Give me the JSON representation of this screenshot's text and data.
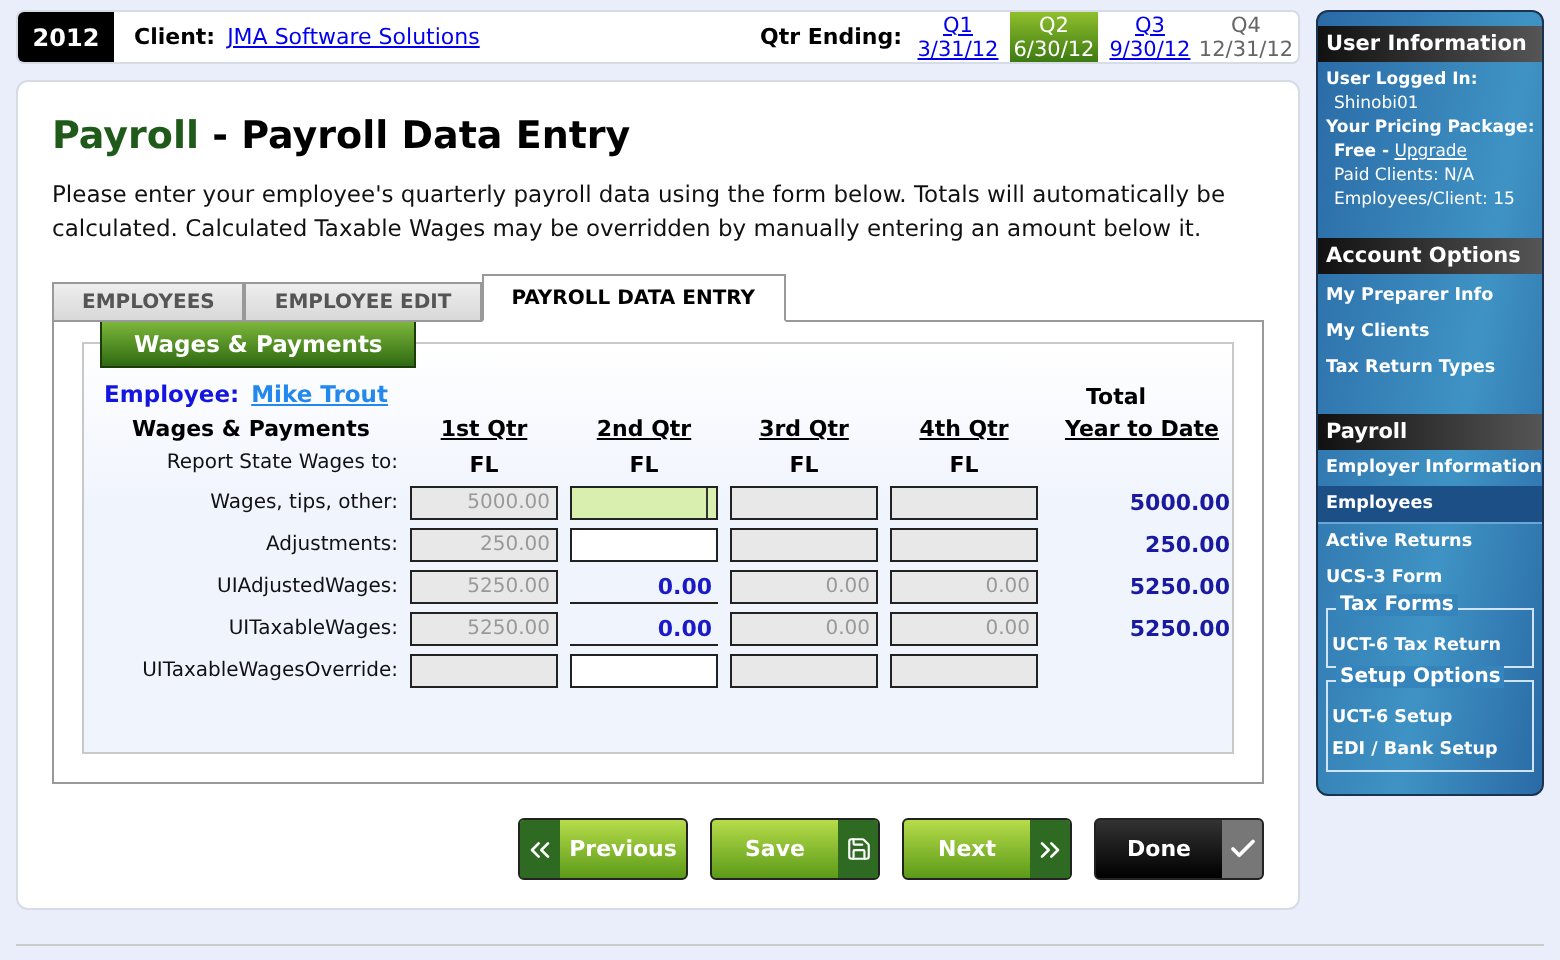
{
  "top_bar": {
    "year": "2012",
    "client_label": "Client:",
    "client": "JMA Software Solutions",
    "qtr_label": "Qtr Ending:",
    "quarters": [
      {
        "name": "Q1",
        "date": "3/31/12",
        "selected": false,
        "disabled": false
      },
      {
        "name": "Q2",
        "date": "6/30/12",
        "selected": true,
        "disabled": false
      },
      {
        "name": "Q3",
        "date": "9/30/12",
        "selected": false,
        "disabled": false
      },
      {
        "name": "Q4",
        "date": "12/31/12",
        "selected": false,
        "disabled": true
      }
    ]
  },
  "heading": {
    "section": "Payroll",
    "title": "- Payroll Data Entry"
  },
  "intro": "Please enter your employee's quarterly payroll data using the form below. Totals will automatically be calculated. Calculated Taxable Wages may be overridden by manually entering an amount below it.",
  "tabs": [
    {
      "label": "EMPLOYEES",
      "selected": false
    },
    {
      "label": "EMPLOYEE EDIT",
      "selected": false
    },
    {
      "label": "PAYROLL DATA ENTRY",
      "selected": true
    }
  ],
  "form": {
    "legend": "Wages & Payments",
    "employee_label": "Employee:",
    "employee_name": "Mike Trout",
    "row_header": "Wages & Payments",
    "quarter_headers": [
      "1st Qtr",
      "2nd Qtr",
      "3rd Qtr",
      "4th Qtr"
    ],
    "total_header": [
      "Total",
      "Year to Date"
    ],
    "state_label": "Report State Wages to:",
    "states": [
      "FL",
      "FL",
      "FL",
      "FL"
    ],
    "rows": [
      {
        "label": "Wages, tips, other:",
        "total": "5000.00",
        "cells": [
          {
            "kind": "readonly",
            "value": "5000.00",
            "focused": false
          },
          {
            "kind": "input",
            "focused": true
          },
          {
            "kind": "readonly",
            "focused": false
          },
          {
            "kind": "readonly",
            "focused": false
          }
        ]
      },
      {
        "label": "Adjustments:",
        "total": "250.00",
        "cells": [
          {
            "kind": "readonly",
            "value": "250.00",
            "focused": false
          },
          {
            "kind": "input",
            "focused": false
          },
          {
            "kind": "readonly",
            "focused": false
          },
          {
            "kind": "readonly",
            "focused": false
          }
        ]
      },
      {
        "label": "UIAdjustedWages:",
        "total": "5250.00",
        "cells": [
          {
            "kind": "readonly",
            "value": "5250.00",
            "focused": false
          },
          {
            "kind": "computed",
            "value": "0.00",
            "focused": false
          },
          {
            "kind": "readonly",
            "value": "0.00",
            "focused": false
          },
          {
            "kind": "readonly",
            "value": "0.00",
            "focused": false
          }
        ]
      },
      {
        "label": "UITaxableWages:",
        "total": "5250.00",
        "cells": [
          {
            "kind": "readonly",
            "value": "5250.00",
            "focused": false
          },
          {
            "kind": "computed",
            "value": "0.00",
            "focused": false
          },
          {
            "kind": "readonly",
            "value": "0.00",
            "focused": false
          },
          {
            "kind": "readonly",
            "value": "0.00",
            "focused": false
          }
        ]
      },
      {
        "label": "UITaxableWagesOverride:",
        "cells": [
          {
            "kind": "readonly",
            "focused": false
          },
          {
            "kind": "input",
            "focused": false
          },
          {
            "kind": "readonly",
            "focused": false
          },
          {
            "kind": "readonly",
            "focused": false
          }
        ]
      }
    ]
  },
  "buttons": [
    {
      "label": "Previous",
      "kind": "previous"
    },
    {
      "label": "Save",
      "kind": "save"
    },
    {
      "label": "Next",
      "kind": "next"
    },
    {
      "label": "Done",
      "kind": "done"
    }
  ],
  "sidebar": {
    "user_info": {
      "title": "User Information",
      "logged_in_label": "User Logged In:",
      "username": "Shinobi01",
      "package_label": "Your Pricing Package:",
      "package": "Free -",
      "upgrade": "Upgrade",
      "paid_clients": "Paid Clients: N/A",
      "employees_per_client": "Employees/Client: 15"
    },
    "account_options": {
      "title": "Account Options",
      "items": [
        {
          "label": "My Preparer Info",
          "selected": false
        },
        {
          "label": "My Clients",
          "selected": false
        },
        {
          "label": "Tax Return Types",
          "selected": false
        }
      ]
    },
    "payroll": {
      "title": "Payroll",
      "items": [
        {
          "label": "Employer Information",
          "selected": false
        },
        {
          "label": "Employees",
          "selected": true
        },
        {
          "label": "Active Returns",
          "selected": false
        },
        {
          "label": "UCS-3 Form",
          "selected": false
        }
      ],
      "groups": [
        {
          "title": "Tax Forms",
          "items": [
            {
              "label": "UCT-6 Tax Return",
              "selected": false
            }
          ]
        },
        {
          "title": "Setup Options",
          "items": [
            {
              "label": "UCT-6 Setup",
              "selected": false
            },
            {
              "label": "EDI / Bank Setup",
              "selected": false
            }
          ]
        }
      ]
    }
  }
}
